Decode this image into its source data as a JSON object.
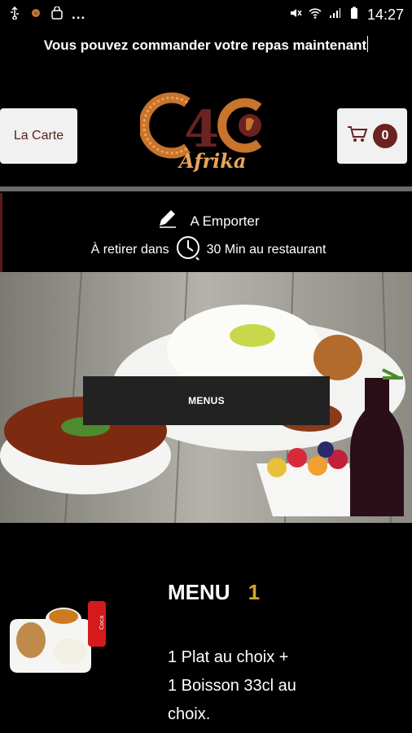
{
  "status_bar": {
    "time": "14:27",
    "left_icons": [
      "usb-icon",
      "app-icon",
      "bag-icon"
    ],
    "overflow": "...",
    "right_icons": [
      "mute-icon",
      "wifi-icon",
      "signal-icon",
      "battery-icon"
    ]
  },
  "promo": {
    "text": "Vous pouvez commander votre repas maintenant"
  },
  "header": {
    "carte_label": "La Carte",
    "cart_count": "0",
    "logo": {
      "main": "C4C",
      "script": "Afrika"
    }
  },
  "order_mode": {
    "label": "A Emporter",
    "pickup_prefix": "À retirer dans",
    "pickup_time": "30 Min au restaurant"
  },
  "hero": {
    "button_label": "MENUS"
  },
  "menu_item": {
    "title": "MENU",
    "number": "1",
    "description_line1": "1 Plat au choix +",
    "description_line2": "1 Boisson 33cl au choix."
  },
  "colors": {
    "accent": "#6b2222",
    "gold": "#d4a62a",
    "background": "#000000"
  }
}
